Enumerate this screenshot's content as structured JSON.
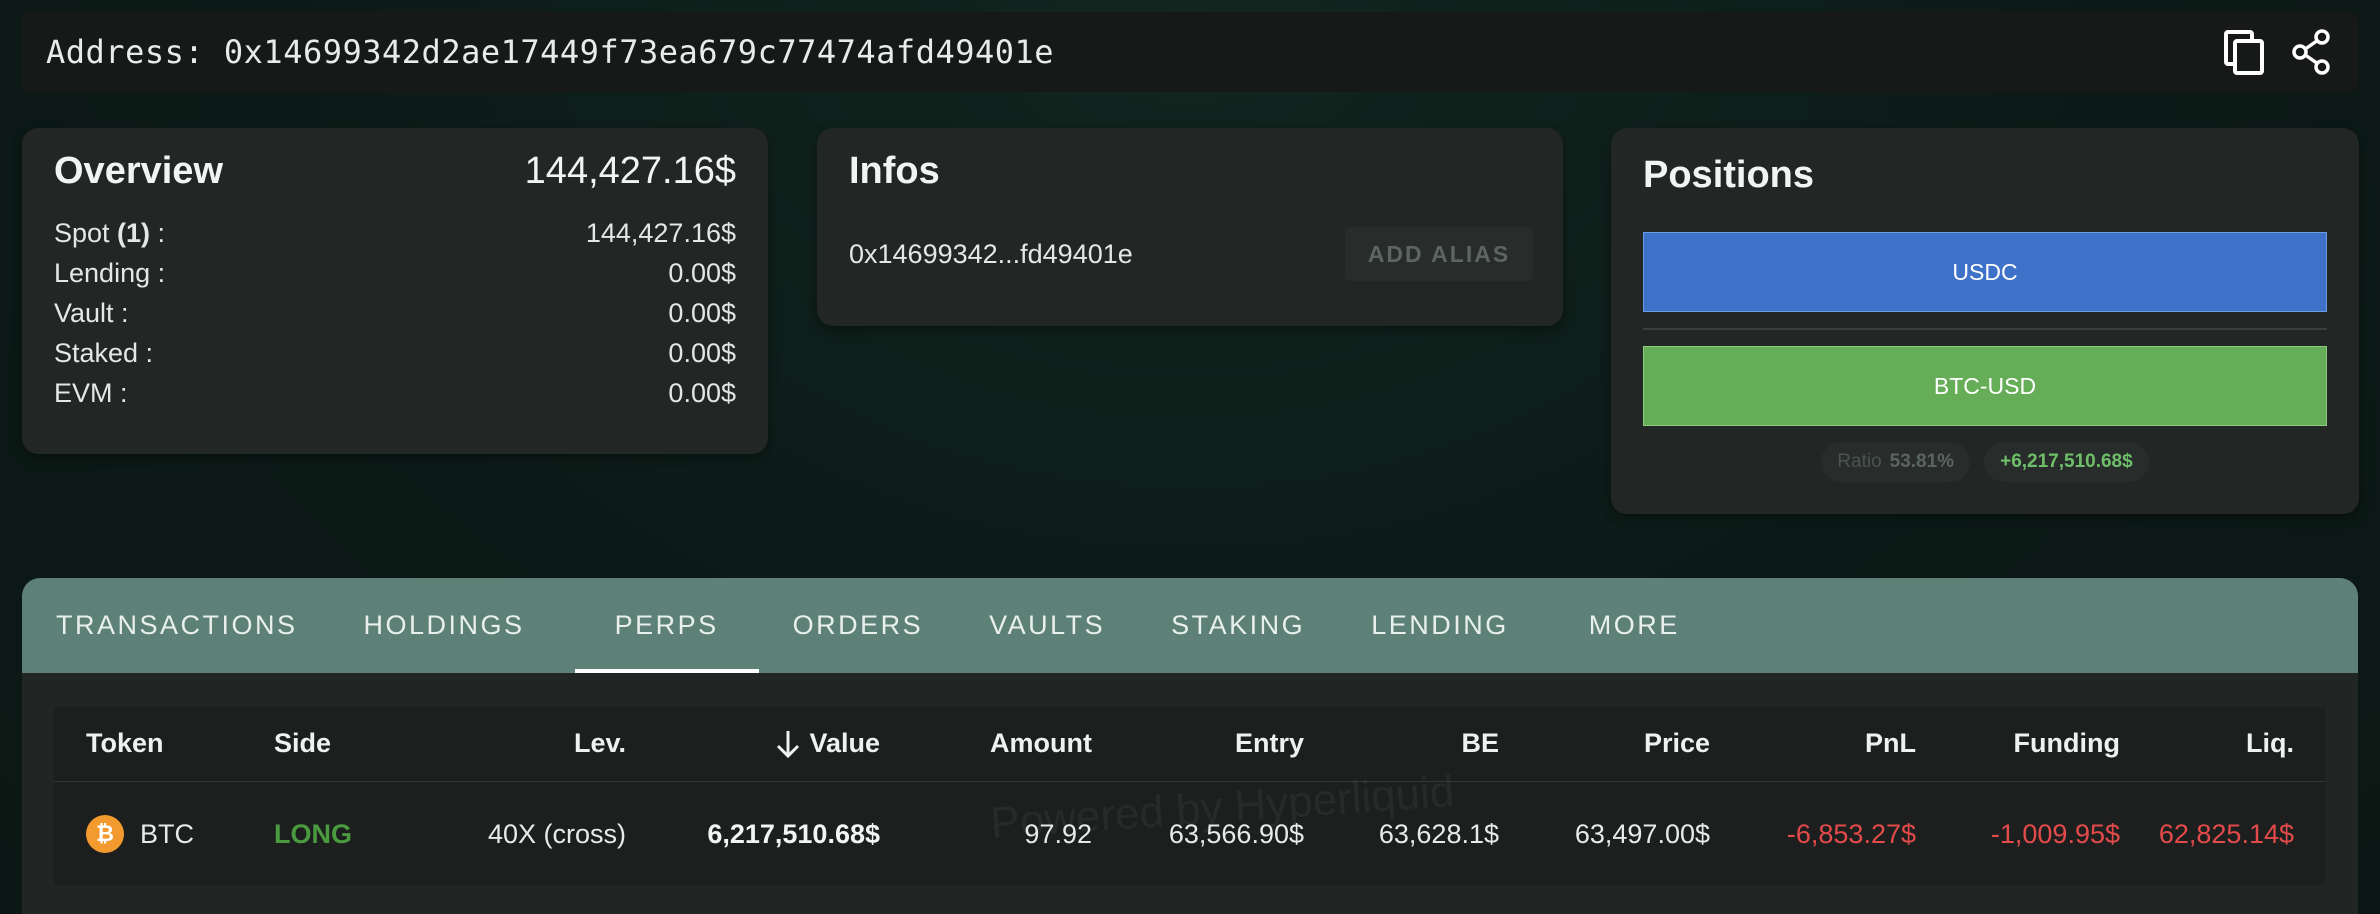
{
  "address_bar": {
    "label": "Address:",
    "address": "0x14699342d2ae17449f73ea679c77474afd49401e",
    "full_text": "Address: 0x14699342d2ae17449f73ea679c77474afd49401e",
    "icons": [
      "copy-icon",
      "share-icon"
    ]
  },
  "overview": {
    "title": "Overview",
    "total": "144,427.16$",
    "rows": [
      {
        "label_prefix": "Spot ",
        "label_bold": "(1)",
        "label_suffix": " :",
        "value": "144,427.16$"
      },
      {
        "label_prefix": "Lending :",
        "label_bold": "",
        "label_suffix": "",
        "value": "0.00$"
      },
      {
        "label_prefix": "Vault :",
        "label_bold": "",
        "label_suffix": "",
        "value": "0.00$"
      },
      {
        "label_prefix": "Staked :",
        "label_bold": "",
        "label_suffix": "",
        "value": "0.00$"
      },
      {
        "label_prefix": "EVM :",
        "label_bold": "",
        "label_suffix": "",
        "value": "0.00$"
      }
    ]
  },
  "infos": {
    "title": "Infos",
    "short_address": "0x14699342...fd49401e",
    "alias_button": "ADD ALIAS"
  },
  "positions": {
    "title": "Positions",
    "bars": [
      {
        "label": "USDC",
        "color": "#3e72c8"
      },
      {
        "label": "BTC-USD",
        "color": "#66ad58"
      }
    ],
    "ratio_label": "Ratio",
    "ratio_value": "53.81%",
    "pnl": "+6,217,510.68$"
  },
  "tabs": {
    "items": [
      "TRANSACTIONS",
      "HOLDINGS",
      "PERPS",
      "ORDERS",
      "VAULTS",
      "STAKING",
      "LENDING",
      "MORE"
    ],
    "active": "PERPS"
  },
  "table": {
    "watermark": "Powered by Hyperliquid",
    "columns": [
      "Token",
      "Side",
      "Lev.",
      "Value",
      "Amount",
      "Entry",
      "BE",
      "Price",
      "PnL",
      "Funding",
      "Liq."
    ],
    "sort_icon": "arrow-down-icon",
    "rows": [
      {
        "token_icon": "bitcoin-icon",
        "token": "BTC",
        "side": "LONG",
        "lev": "40X (cross)",
        "value": "6,217,510.68$",
        "amount": "97.92",
        "entry": "63,566.90$",
        "be": "63,628.1$",
        "price": "63,497.00$",
        "pnl": "-6,853.27$",
        "funding": "-1,009.95$",
        "liq": "62,825.14$"
      }
    ]
  },
  "colors": {
    "background": "#0c1a17",
    "card": "#222625",
    "tabbar": "#5d8177",
    "long": "#4a9b3f",
    "negative": "#e34b4b",
    "usdc": "#3e72c8",
    "btc": "#66ad58"
  }
}
